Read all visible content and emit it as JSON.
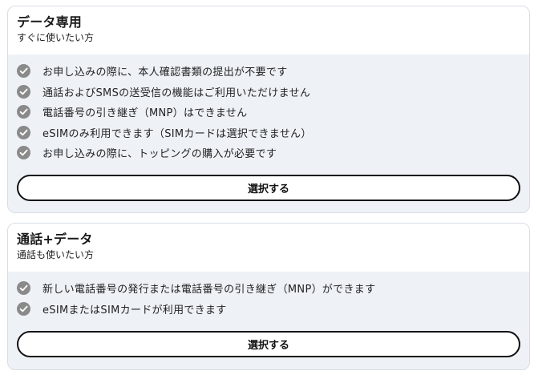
{
  "plans": [
    {
      "title": "データ専用",
      "subtitle": "すぐに使いたい方",
      "features": [
        "お申し込みの際に、本人確認書類の提出が不要です",
        "通話およびSMSの送受信の機能はご利用いただけません",
        "電話番号の引き継ぎ（MNP）はできません",
        "eSIMのみ利用できます（SIMカードは選択できません）",
        "お申し込みの際に、トッピングの購入が必要です"
      ],
      "button_label": "選択する"
    },
    {
      "title": "通話+データ",
      "subtitle": "通話も使いたい方",
      "features": [
        "新しい電話番号の発行または電話番号の引き継ぎ（MNP）ができます",
        "eSIMまたはSIMカードが利用できます"
      ],
      "button_label": "選択する"
    }
  ],
  "icons": {
    "feature_icon": "check-circle-icon"
  },
  "colors": {
    "check_circle": "#8a8a8a",
    "card_body_bg": "#eef2f7",
    "border": "#d9dde3",
    "button_border": "#111111"
  }
}
